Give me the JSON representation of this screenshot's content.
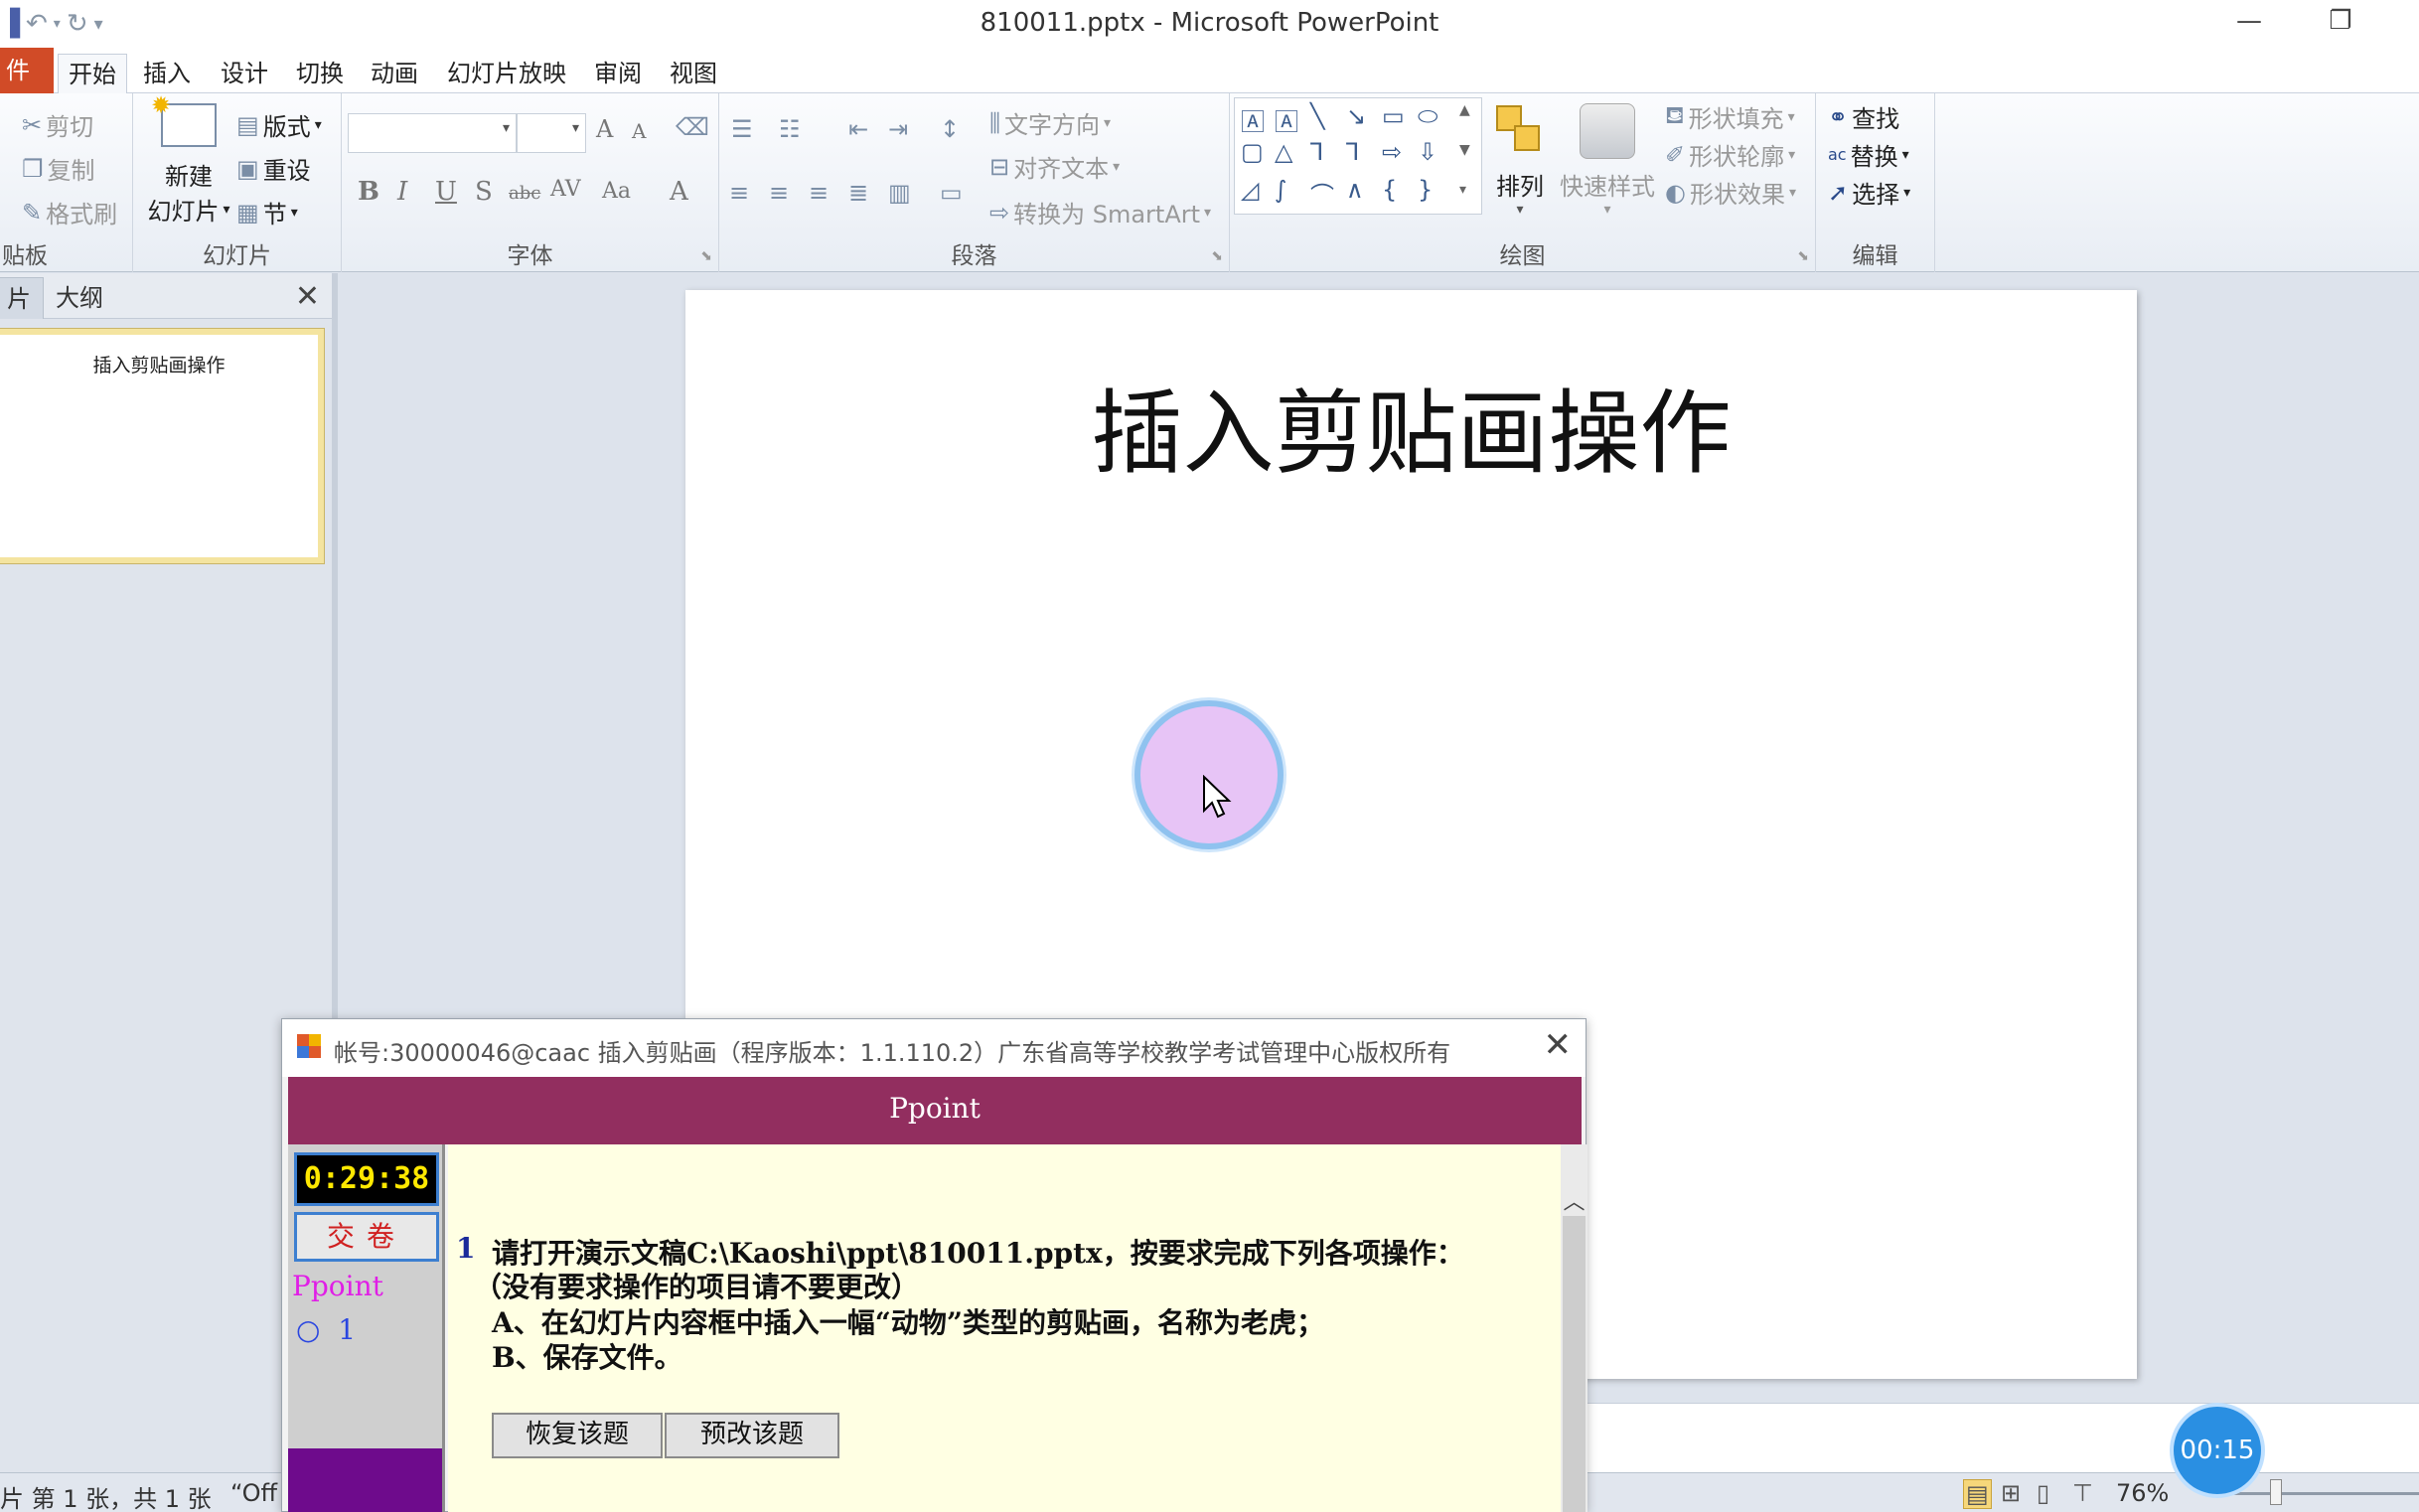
{
  "window": {
    "title": "810011.pptx - Microsoft PowerPoint",
    "minimize_icon": "—",
    "restore_icon": "❐"
  },
  "qat": {
    "save_icon": "▐",
    "undo_icon": "↶",
    "redo_icon": "↻",
    "customize_icon": "▾"
  },
  "tabs": {
    "file": "件",
    "items": [
      "开始",
      "插入",
      "设计",
      "切换",
      "动画",
      "幻灯片放映",
      "审阅",
      "视图"
    ]
  },
  "ribbon": {
    "clipboard": {
      "label": "贴板",
      "cut": "剪切",
      "copy": "复制",
      "format_painter": "格式刷"
    },
    "slides": {
      "label": "幻灯片",
      "new_slide_line1": "新建",
      "new_slide_line2": "幻灯片",
      "layout": "版式",
      "reset": "重设",
      "section": "节"
    },
    "font": {
      "label": "字体",
      "bold": "B",
      "italic": "I",
      "underline": "U",
      "shadow": "S",
      "strike": "abc",
      "spacing": "AV",
      "case": "Aa",
      "color": "A",
      "grow": "A",
      "shrink": "A"
    },
    "paragraph": {
      "label": "段落",
      "text_direction": "文字方向",
      "align_text": "对齐文本",
      "smartart": "转换为 SmartArt"
    },
    "drawing": {
      "label": "绘图",
      "arrange": "排列",
      "quick_styles": "快速样式",
      "shape_fill": "形状填充",
      "shape_outline": "形状轮廓",
      "shape_effects": "形状效果"
    },
    "editing": {
      "label": "编辑",
      "find": "查找",
      "replace": "替换",
      "select": "选择"
    }
  },
  "left_pane": {
    "tab_slides": "片",
    "tab_outline": "大纲",
    "close_icon": "✕",
    "thumbnail_text": "插入剪贴画操作"
  },
  "slide": {
    "title": "插入剪贴画操作"
  },
  "status_bar": {
    "slide_info": "片 第 1 张，共 1 张",
    "theme": "“Off",
    "zoom": "76%"
  },
  "timer_bubble": "00:15",
  "dialog": {
    "title": "帐号:30000046@caac  插入剪贴画（程序版本：1.1.110.2）广东省高等学校教学考试管理中心版权所有",
    "close_icon": "✕",
    "banner": "Ppoint",
    "clock": "0:29:38",
    "submit": "交卷",
    "subject": "Ppoint",
    "question_item": "○  1",
    "question_number": "1",
    "lines": [
      "请打开演示文稿C:\\Kaoshi\\ppt\\810011.pptx，按要求完成下列各项操作：",
      "（没有要求操作的项目请不要更改）",
      "A、在幻灯片内容框中插入一幅“动物”类型的剪贴画，名称为老虎；",
      "B、保存文件。"
    ],
    "restore_button": "恢复该题",
    "preview_button": "预改该题"
  }
}
